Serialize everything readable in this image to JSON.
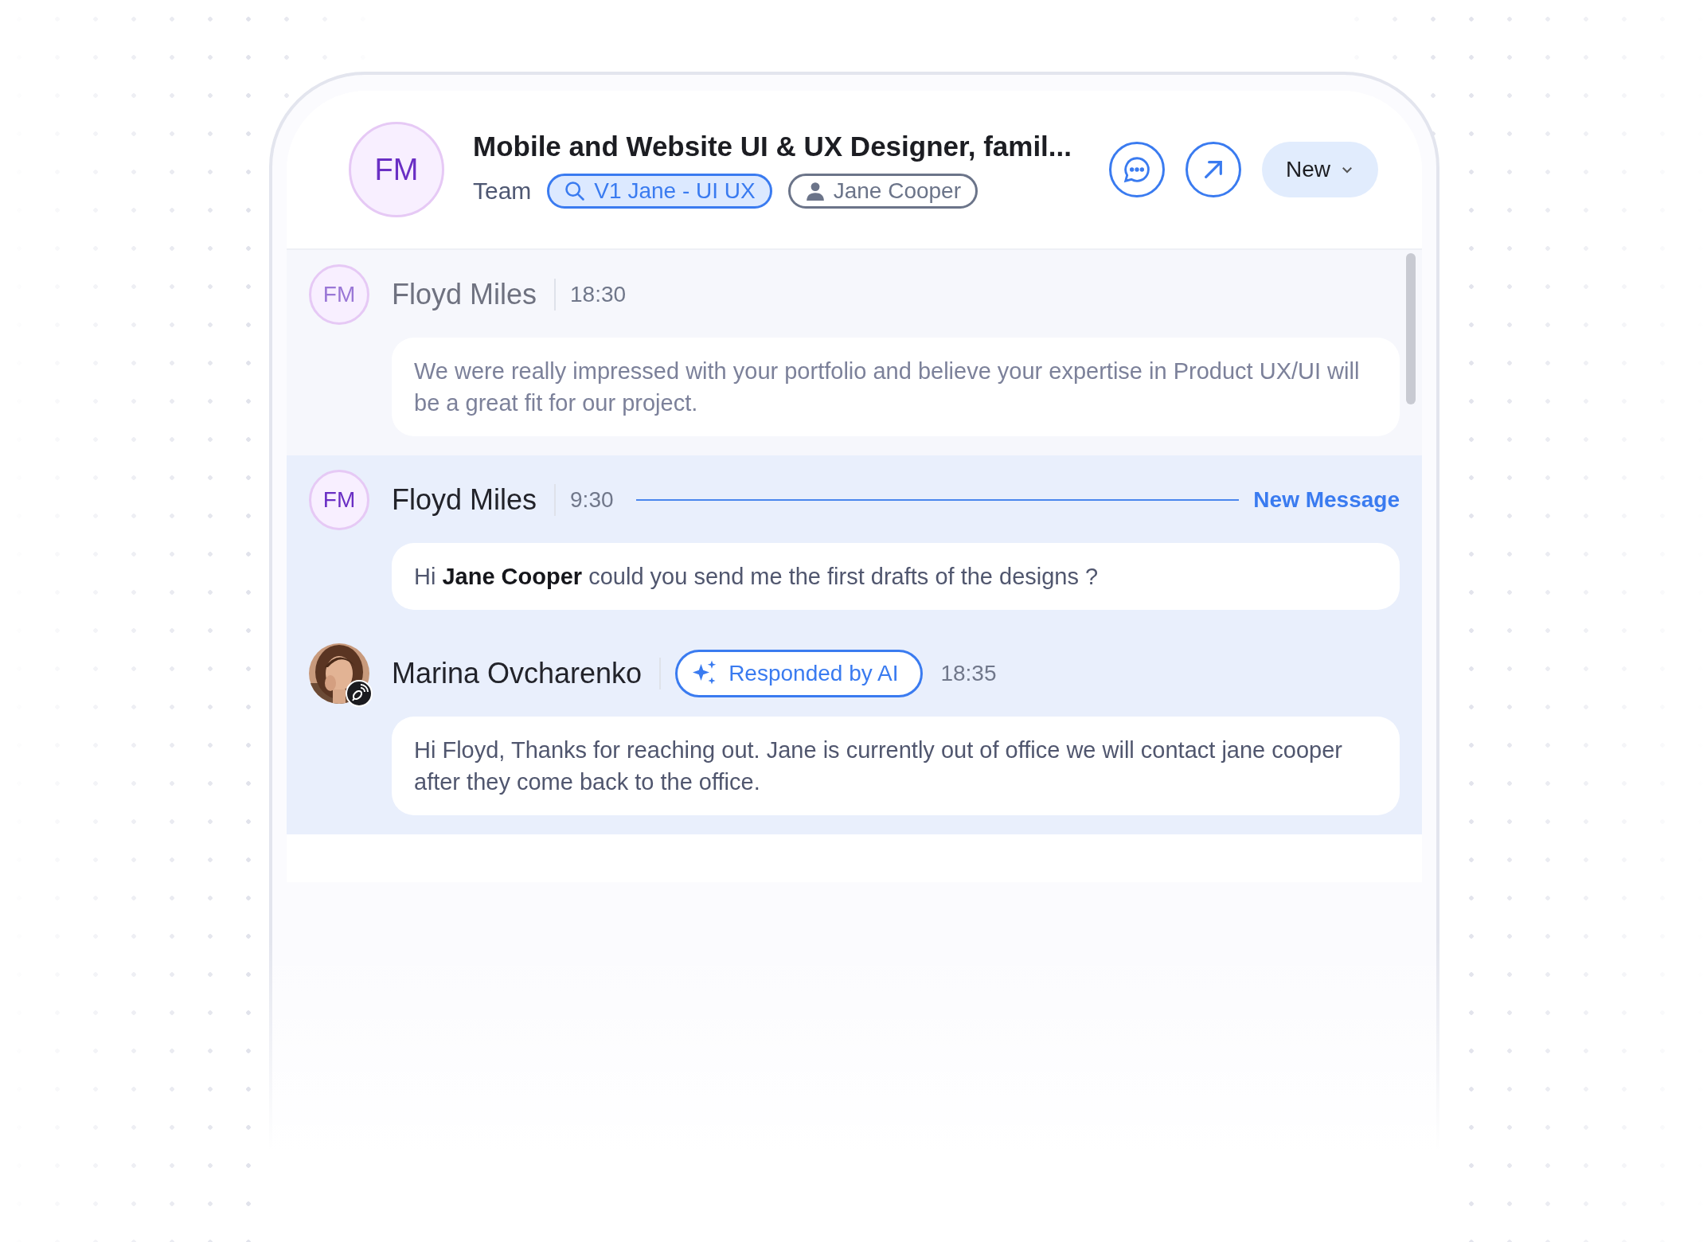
{
  "header": {
    "avatar": "FM",
    "title": "Mobile and Website UI & UX Designer, famil...",
    "team_label": "Team",
    "chips": [
      {
        "kind": "search",
        "label": "V1 Jane - UI UX"
      },
      {
        "kind": "person",
        "label": "Jane Cooper"
      }
    ],
    "dropdown": {
      "label": "New"
    }
  },
  "messages": [
    {
      "avatar": {
        "kind": "initials",
        "text": "FM"
      },
      "name": "Floyd Miles",
      "time": "18:30",
      "highlighted": false,
      "read": true,
      "text": "We were really impressed with your portfolio and believe your expertise in Product UX/UI will be a great fit for our project."
    },
    {
      "avatar": {
        "kind": "initials",
        "text": "FM"
      },
      "name": "Floyd Miles",
      "time": "9:30",
      "highlighted": true,
      "read": false,
      "new_marker": "New Message",
      "text": "Hi **Jane Cooper** could you send me the first drafts of the designs ?"
    },
    {
      "name": "Marina Ovcharenko",
      "badge": "Responded by AI",
      "time": "18:35",
      "highlighted": true,
      "text": "Hi Floyd, Thanks for reaching out. Jane is currently out of office we will contact jane cooper after they come back to the office."
    }
  ]
}
